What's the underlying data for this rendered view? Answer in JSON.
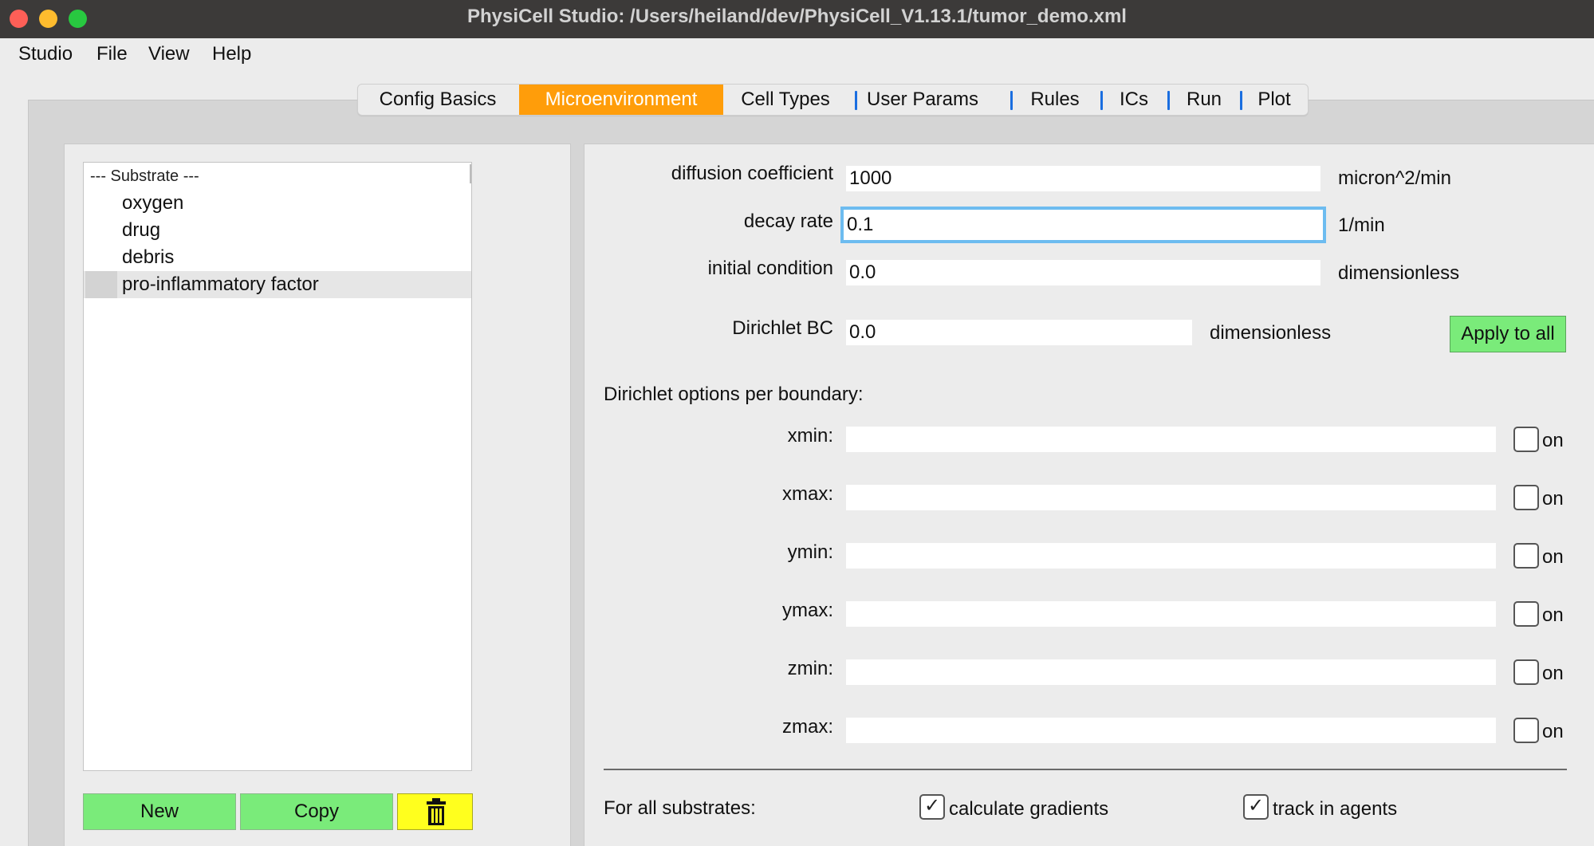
{
  "window": {
    "title": "PhysiCell Studio: /Users/heiland/dev/PhysiCell_V1.13.1/tumor_demo.xml"
  },
  "menu": [
    "Studio",
    "File",
    "View",
    "Help"
  ],
  "tabs": [
    "Config Basics",
    "Microenvironment",
    "Cell Types",
    "User Params",
    "Rules",
    "ICs",
    "Run",
    "Plot"
  ],
  "active_tab": "Microenvironment",
  "substrates": {
    "header": "---  Substrate ---",
    "items": [
      "oxygen",
      "drug",
      "debris",
      "pro-inflammatory factor"
    ],
    "selected": "pro-inflammatory factor"
  },
  "buttons": {
    "new": "New",
    "copy": "Copy",
    "delete_icon": "trash-icon",
    "apply_to_all": "Apply to all"
  },
  "params": {
    "diffusion_coefficient": {
      "label": "diffusion coefficient",
      "value": "1000",
      "unit": "micron^2/min"
    },
    "decay_rate": {
      "label": "decay rate",
      "value": "0.1",
      "unit": "1/min"
    },
    "initial_condition": {
      "label": "initial condition",
      "value": "0.0",
      "unit": "dimensionless"
    },
    "dirichlet_bc": {
      "label": "Dirichlet BC",
      "value": "0.0",
      "unit": "dimensionless"
    }
  },
  "dirichlet_options": {
    "label": "Dirichlet options per boundary:",
    "boundaries": [
      {
        "label": "xmin:",
        "value": "",
        "on_label": "on",
        "checked": false
      },
      {
        "label": "xmax:",
        "value": "",
        "on_label": "on",
        "checked": false
      },
      {
        "label": "ymin:",
        "value": "",
        "on_label": "on",
        "checked": false
      },
      {
        "label": "ymax:",
        "value": "",
        "on_label": "on",
        "checked": false
      },
      {
        "label": "zmin:",
        "value": "",
        "on_label": "on",
        "checked": false
      },
      {
        "label": "zmax:",
        "value": "",
        "on_label": "on",
        "checked": false
      }
    ]
  },
  "all_substrates": {
    "label": "For all substrates:",
    "calculate_gradients": {
      "label": "calculate gradients",
      "checked": true
    },
    "track_in_agents": {
      "label": "track in agents",
      "checked": true
    }
  },
  "colors": {
    "active_tab": "#ff9d0a",
    "green_button": "#7aeb7a",
    "delete_button": "#ffff1e",
    "focus_ring": "#6dbcf0",
    "tab_separator": "#1a6ee0"
  }
}
